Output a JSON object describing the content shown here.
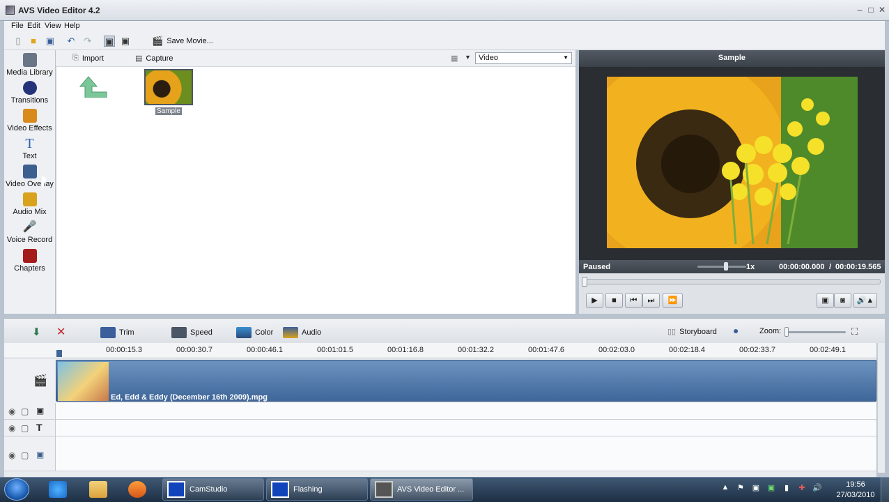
{
  "window": {
    "title": "AVS Video Editor 4.2",
    "min": "–",
    "max": "□",
    "close": "✕"
  },
  "menu": [
    "File",
    "Edit",
    "View",
    "Help"
  ],
  "toolbar": {
    "save_movie": "Save Movie..."
  },
  "sidebar": [
    {
      "label": "Media Library",
      "icon": "film-stack-icon",
      "color": "#6a7686"
    },
    {
      "label": "Transitions",
      "icon": "transition-icon",
      "color": "#24337a"
    },
    {
      "label": "Video Effects",
      "icon": "effects-icon",
      "color": "#d98a1c"
    },
    {
      "label": "Text",
      "icon": "text-icon",
      "color": "#2a61b3"
    },
    {
      "label": "Video Overlay",
      "icon": "overlay-icon",
      "color": "#3d5f8f"
    },
    {
      "label": "Audio Mix",
      "icon": "audio-mix-icon",
      "color": "#d9a21c"
    },
    {
      "label": "Voice Record",
      "icon": "microphone-icon",
      "color": "#5a5f66"
    },
    {
      "label": "Chapters",
      "icon": "chapters-icon",
      "color": "#a51a1a"
    }
  ],
  "library": {
    "import": "Import",
    "capture": "Capture",
    "filter": "Video",
    "items": [
      {
        "label": "Sample"
      }
    ]
  },
  "preview": {
    "title": "Sample",
    "status": "Paused",
    "speed": "1x",
    "time_current": "00:00:00.000",
    "time_separator": "/",
    "time_total": "00:00:19.565"
  },
  "edit_bar": {
    "trim": "Trim",
    "speed": "Speed",
    "color": "Color",
    "audio": "Audio",
    "storyboard": "Storyboard",
    "zoom": "Zoom:"
  },
  "timeline": {
    "ticks": [
      "00:00:15.3",
      "00:00:30.7",
      "00:00:46.1",
      "00:01:01.5",
      "00:01:16.8",
      "00:01:32.2",
      "00:01:47.6",
      "00:02:03.0",
      "00:02:18.4",
      "00:02:33.7",
      "00:02:49.1"
    ],
    "clip": "Ed, Edd & Eddy (December 16th 2009).mpg"
  },
  "taskbar": {
    "tasks": [
      "CamStudio",
      "Flashing",
      "AVS Video Editor ..."
    ],
    "time": "19:56",
    "date": "27/03/2010"
  },
  "colors": {
    "accent": "#3e6699",
    "header_dark": "#3b4149"
  }
}
